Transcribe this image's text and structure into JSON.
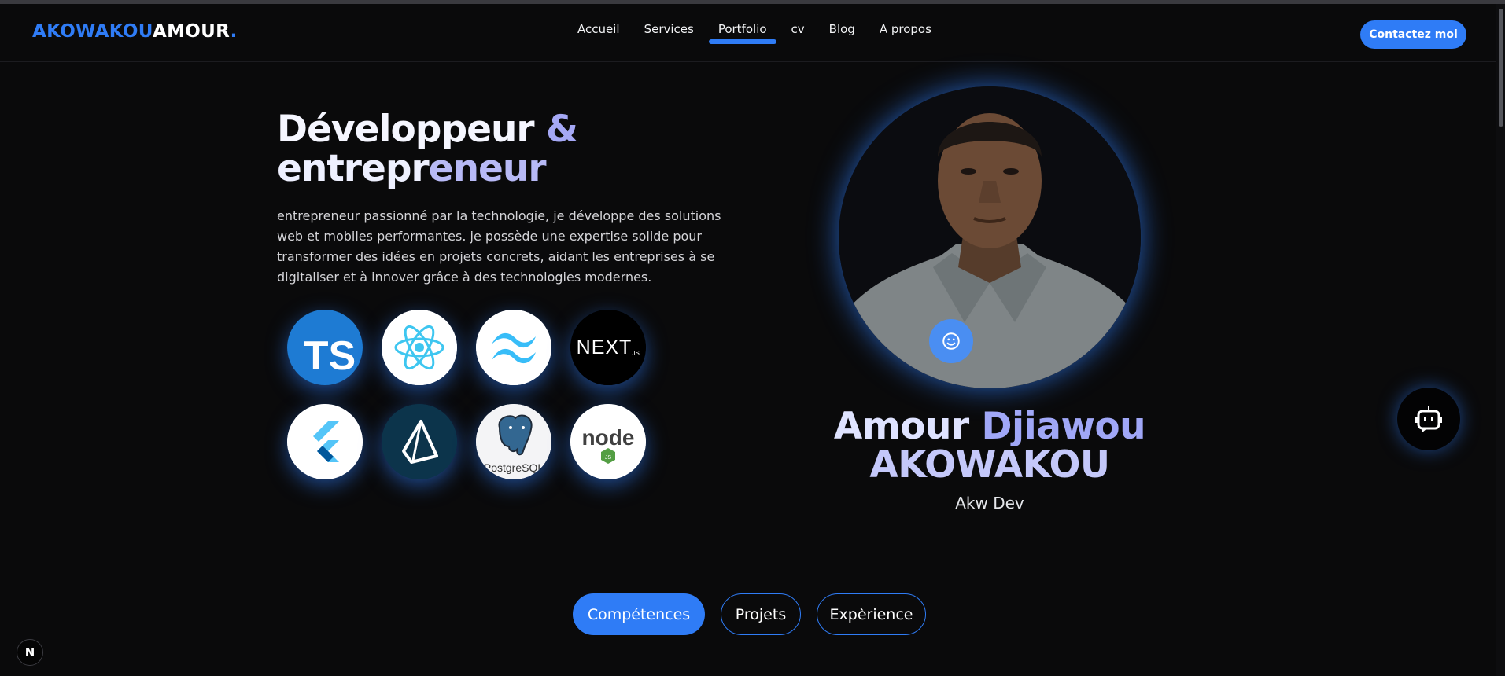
{
  "logo": {
    "part1": "AKOWAKOU",
    "part2": "AMOUR",
    "dot": "."
  },
  "nav": {
    "items": [
      {
        "label": "Accueil"
      },
      {
        "label": "Services"
      },
      {
        "label": "Portfolio",
        "active": true
      },
      {
        "label": "cv"
      },
      {
        "label": "Blog"
      },
      {
        "label": "A propos"
      }
    ]
  },
  "header": {
    "contact_label": "Contactez moi"
  },
  "hero": {
    "title_line1_a": "Développeur ",
    "title_line1_b": "&",
    "title_line2_a": "entrepr",
    "title_line2_b": "eneur",
    "description": "entrepreneur passionné par la technologie, je développe des solutions web et mobiles performantes. je possède une expertise solide pour transformer des idées en projets concrets, aidant les entreprises à se digitaliser et à innover grâce à des technologies modernes.",
    "tech_icons": [
      {
        "name": "typescript-icon",
        "text": "TS",
        "color": "#3178c6"
      },
      {
        "name": "react-icon",
        "color": "#61dafb"
      },
      {
        "name": "tailwind-icon",
        "color": "#38bdf8"
      },
      {
        "name": "nextjs-icon",
        "text": "NEXT",
        "text_suffix": ".JS",
        "color": "#000000"
      },
      {
        "name": "flutter-icon",
        "color": "#02569b"
      },
      {
        "name": "prisma-icon",
        "color": "#0c344b"
      },
      {
        "name": "postgresql-icon",
        "text": "PostgreSQL",
        "color": "#336791"
      },
      {
        "name": "nodejs-icon",
        "text": "node",
        "text_sub": "JS",
        "color": "#539e43"
      }
    ]
  },
  "profile": {
    "name_a": "Amour ",
    "name_b": "Djiawou",
    "name_line2": "AKOWAKOU",
    "role": "Akw Dev",
    "photo_icon": "person-portrait",
    "smile_icon": "smile-icon"
  },
  "tabs": [
    {
      "label": "Compétences",
      "active": true
    },
    {
      "label": "Projets"
    },
    {
      "label": "Expèrience"
    }
  ],
  "chat_icon": "chatbot-icon",
  "dev_badge": "N",
  "colors": {
    "accent": "#2f7cf6",
    "background": "#0a0a0b",
    "gradient_light": "#eef0ff",
    "gradient_purple": "#a0a7f7"
  }
}
